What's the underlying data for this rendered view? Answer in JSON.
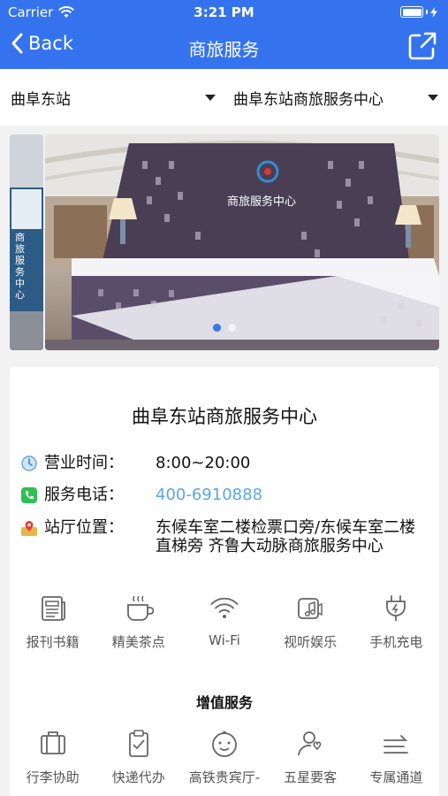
{
  "status": {
    "carrier": "Carrier",
    "time": "3:21 PM"
  },
  "nav": {
    "back_label": "Back",
    "title": "商旅服务"
  },
  "selectors": {
    "station": "曲阜东站",
    "center": "曲阜东站商旅服务中心"
  },
  "banner": {
    "side_text": "商旅服务中心",
    "sign_text": "商旅服务中心",
    "slides": 2,
    "active_slide": 1
  },
  "card": {
    "title": "曲阜东站商旅服务中心",
    "hours_label": "营业时间：",
    "hours_value": "8:00~20:00",
    "phone_label": "服务电话：",
    "phone_value": "400-6910888",
    "location_label": "站厅位置：",
    "location_value": "东候车室二楼检票口旁/东候车室二楼直梯旁 齐鲁大动脉商旅服务中心"
  },
  "facilities": [
    {
      "label": "报刊书籍",
      "icon": "newspaper-icon"
    },
    {
      "label": "精美茶点",
      "icon": "coffee-cup-icon"
    },
    {
      "label": "Wi-Fi",
      "icon": "wifi-icon"
    },
    {
      "label": "视听娱乐",
      "icon": "music-note-icon"
    },
    {
      "label": "手机充电",
      "icon": "charging-plug-icon"
    }
  ],
  "value_added": {
    "title": "增值服务",
    "items": [
      {
        "label": "行李协助",
        "icon": "luggage-icon"
      },
      {
        "label": "快递代办",
        "icon": "clipboard-check-icon"
      },
      {
        "label": "高铁贵宾厅-",
        "icon": "baby-face-icon"
      },
      {
        "label": "五星要客",
        "icon": "vip-person-icon"
      },
      {
        "label": "专属通道",
        "icon": "exclusive-lane-icon"
      }
    ]
  },
  "colors": {
    "primary": "#3573ee",
    "phone": "#5aa6e6",
    "dot_active": "#2f7bf0"
  }
}
